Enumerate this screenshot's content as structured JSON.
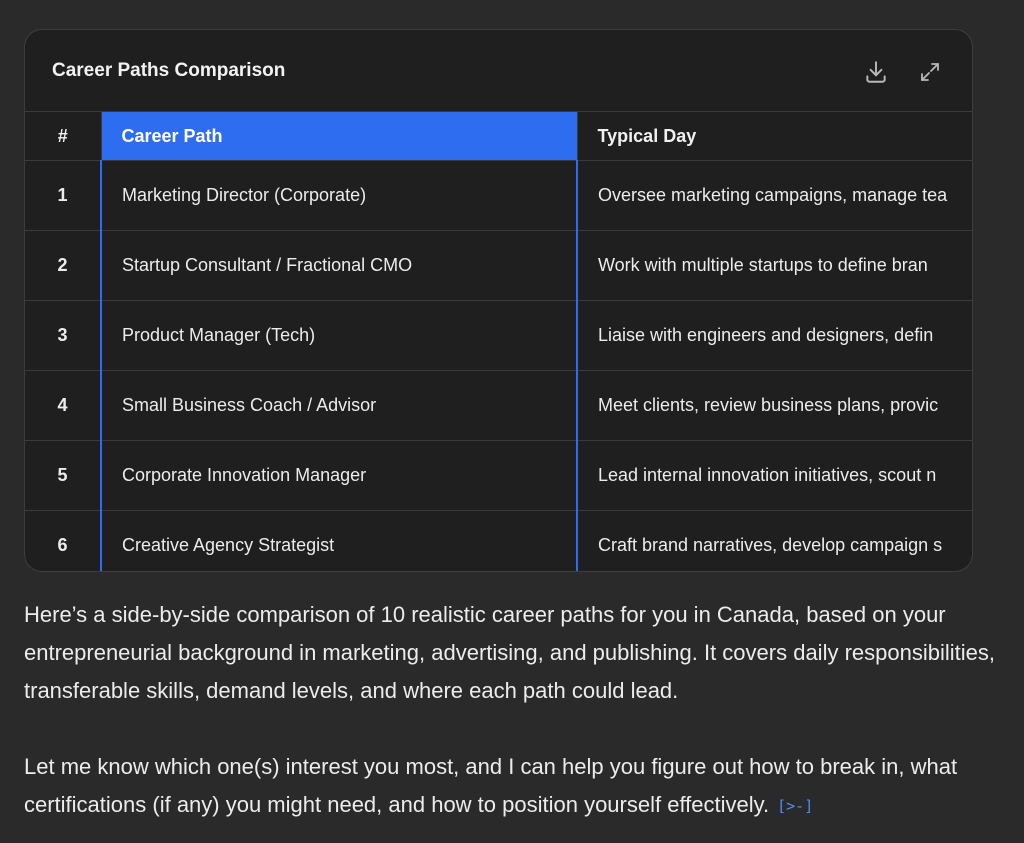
{
  "card": {
    "title": "Career Paths Comparison",
    "actions": [
      {
        "name": "download-icon"
      },
      {
        "name": "expand-icon"
      }
    ]
  },
  "table": {
    "columns": [
      "#",
      "Career Path",
      "Typical Day"
    ],
    "rows": [
      {
        "num": "1",
        "path": "Marketing Director (Corporate)",
        "day": "Oversee marketing campaigns, manage tea"
      },
      {
        "num": "2",
        "path": "Startup Consultant / Fractional CMO",
        "day": "Work with multiple startups to define bran"
      },
      {
        "num": "3",
        "path": "Product Manager (Tech)",
        "day": "Liaise with engineers and designers, defin"
      },
      {
        "num": "4",
        "path": "Small Business Coach / Advisor",
        "day": "Meet clients, review business plans, provic"
      },
      {
        "num": "5",
        "path": "Corporate Innovation Manager",
        "day": "Lead internal innovation initiatives, scout n"
      },
      {
        "num": "6",
        "path": "Creative Agency Strategist",
        "day": "Craft brand narratives, develop campaign s"
      }
    ],
    "selected_column": "Career Path"
  },
  "message": {
    "paragraph1": "Here’s a side-by-side comparison of 10 realistic career paths for you in Canada, based on your entrepreneurial background in marketing, advertising, and publishing. It covers daily responsibilities, transferable skills, demand levels, and where each path could lead.",
    "paragraph2": "Let me know which one(s) interest you most, and I can help you figure out how to break in, what certifications (if any) you might need, and how to position yourself effectively.",
    "cite_glyph": "[>-]"
  },
  "colors": {
    "accent": "#2f6df0",
    "background": "#2a2a2a",
    "card": "#1f1f1f"
  }
}
